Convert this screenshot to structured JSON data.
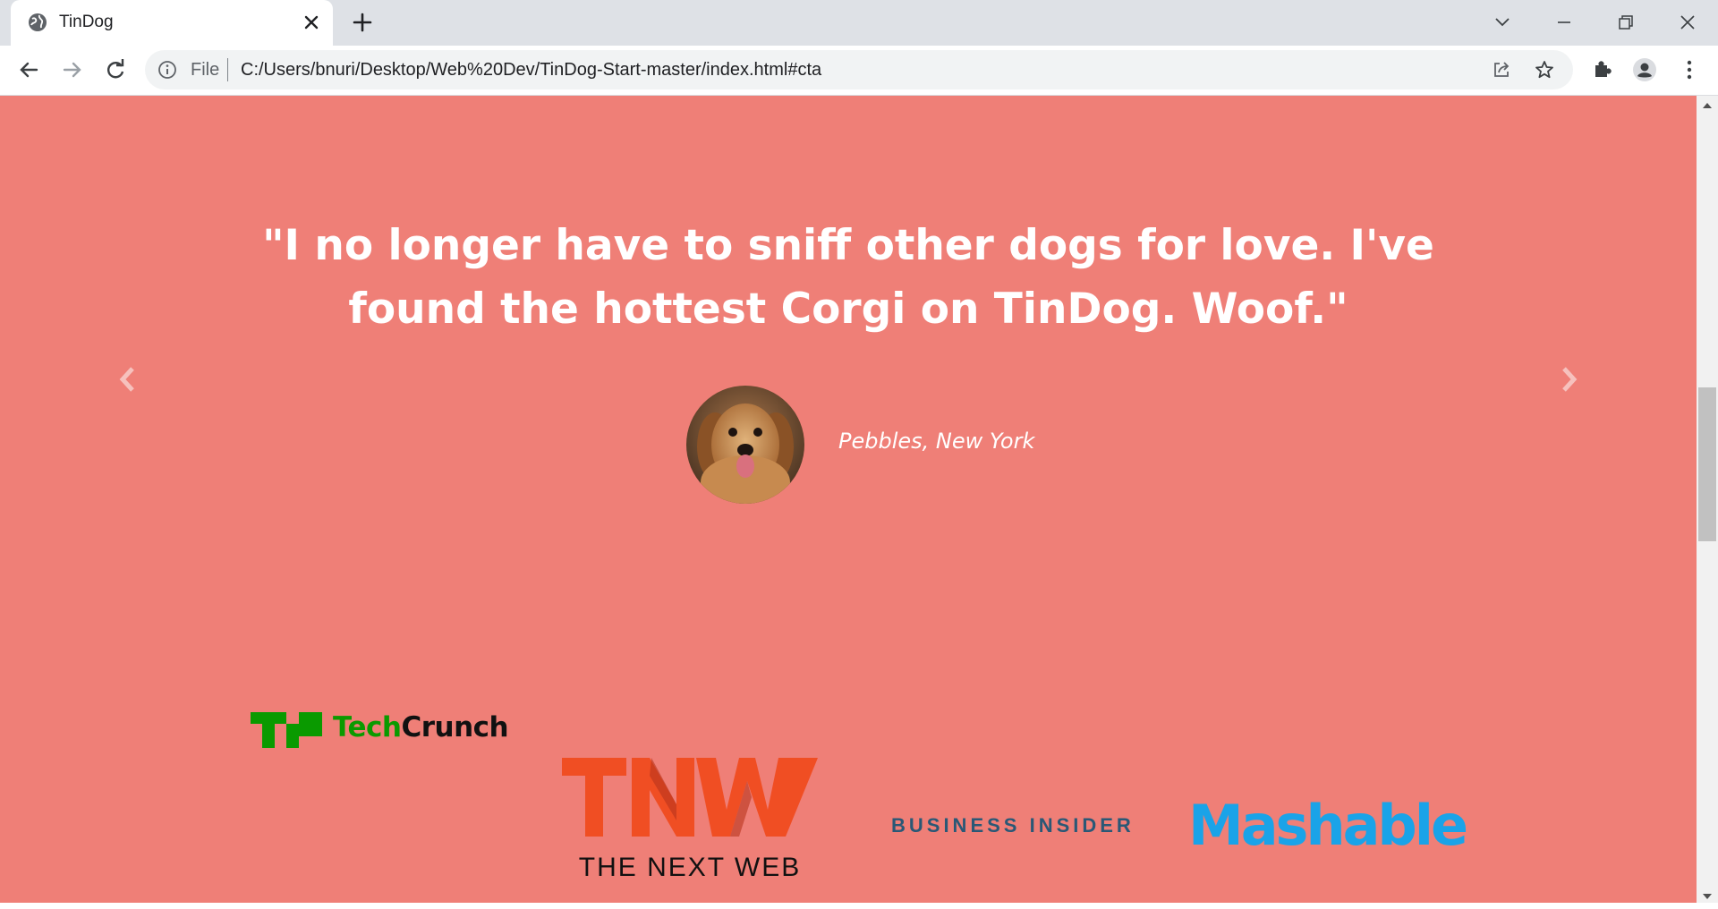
{
  "browser": {
    "tab": {
      "title": "TinDog"
    },
    "address": {
      "scheme_label": "File",
      "url": "C:/Users/bnuri/Desktop/Web%20Dev/TinDog-Start-master/index.html#cta"
    }
  },
  "page": {
    "testimonial": {
      "quote_line1": "\"I no longer have to sniff other dogs for love. I've",
      "quote_line2": "found the hottest Corgi on TinDog. Woof.\"",
      "author": "Pebbles, New York"
    },
    "press": [
      {
        "name": "TechCrunch",
        "part1": "Tech",
        "part2": "Crunch",
        "mark": "TC"
      },
      {
        "name": "The Next Web",
        "mark": "TNW",
        "subtitle": "THE NEXT WEB"
      },
      {
        "name": "Business Insider",
        "text": "BUSINESS INSIDER"
      },
      {
        "name": "Mashable",
        "text": "Mashable"
      }
    ]
  },
  "colors": {
    "section_bg": "#ef7f77",
    "techcrunch_green": "#0a9a00",
    "tnw_red": "#f04e23",
    "business_insider_blue": "#2a5876",
    "mashable_blue": "#1aa3e8"
  },
  "icons": {
    "tab_favicon": "globe-icon",
    "prev": "chevron-left-icon",
    "next": "chevron-right-icon"
  }
}
